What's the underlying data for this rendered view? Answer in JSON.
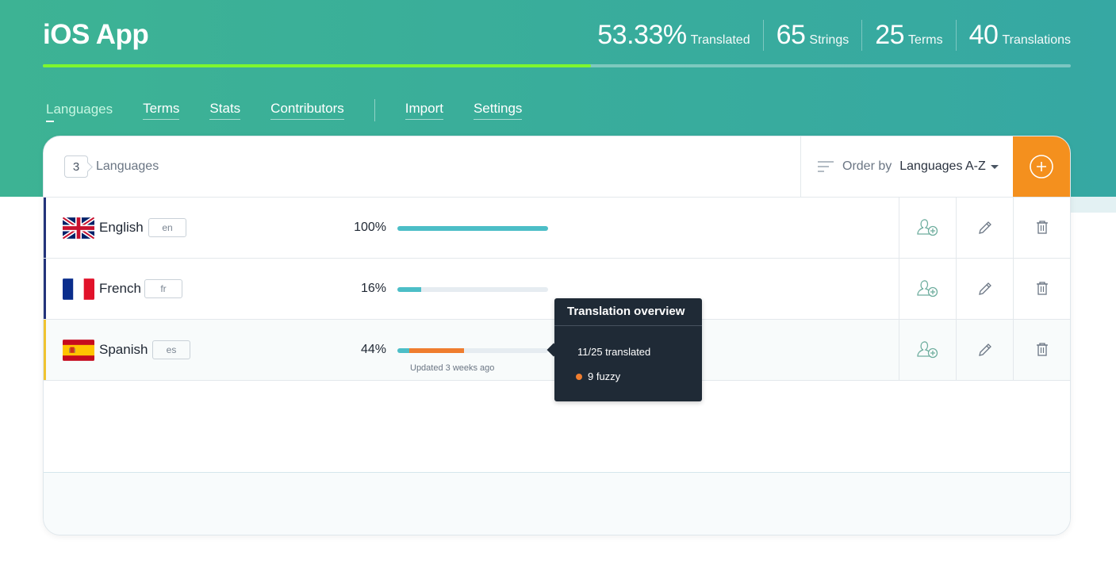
{
  "app": {
    "title": "iOS App"
  },
  "stats": [
    {
      "value": "53.33%",
      "label": "Translated"
    },
    {
      "value": "65",
      "label": "Strings"
    },
    {
      "value": "25",
      "label": "Terms"
    },
    {
      "value": "40",
      "label": "Translations"
    }
  ],
  "overall_progress": {
    "translated_fraction": 0.5333,
    "color": "#7ef72e"
  },
  "nav": {
    "primary": [
      "Languages",
      "Terms",
      "Stats",
      "Contributors"
    ],
    "secondary": [
      "Import",
      "Settings"
    ],
    "active": "Languages"
  },
  "toolbar": {
    "count": "3",
    "count_label": "Languages",
    "order_label": "Order by",
    "order_value": "Languages A-Z",
    "add_icon": "plus-circle-icon"
  },
  "languages": [
    {
      "name": "English",
      "code": "en",
      "percent": "100%",
      "translated_fraction": 1.0,
      "fuzzy_fraction": 0.0,
      "flag": "uk-flag-icon"
    },
    {
      "name": "French",
      "code": "fr",
      "percent": "16%",
      "translated_fraction": 0.16,
      "fuzzy_fraction": 0.0,
      "flag": "france-flag-icon"
    },
    {
      "name": "Spanish",
      "code": "es",
      "percent": "44%",
      "translated_fraction": 0.08,
      "fuzzy_fraction": 0.36,
      "flag": "spain-flag-icon",
      "updated": "Updated 3 weeks ago"
    }
  ],
  "tooltip": {
    "title": "Translation overview",
    "translated": "11/25 translated",
    "fuzzy": "9 fuzzy"
  },
  "colors": {
    "accent": "#f4901e",
    "translated": "#4cbec7",
    "fuzzy": "#ef7d2f",
    "header": "#39ad9b"
  }
}
